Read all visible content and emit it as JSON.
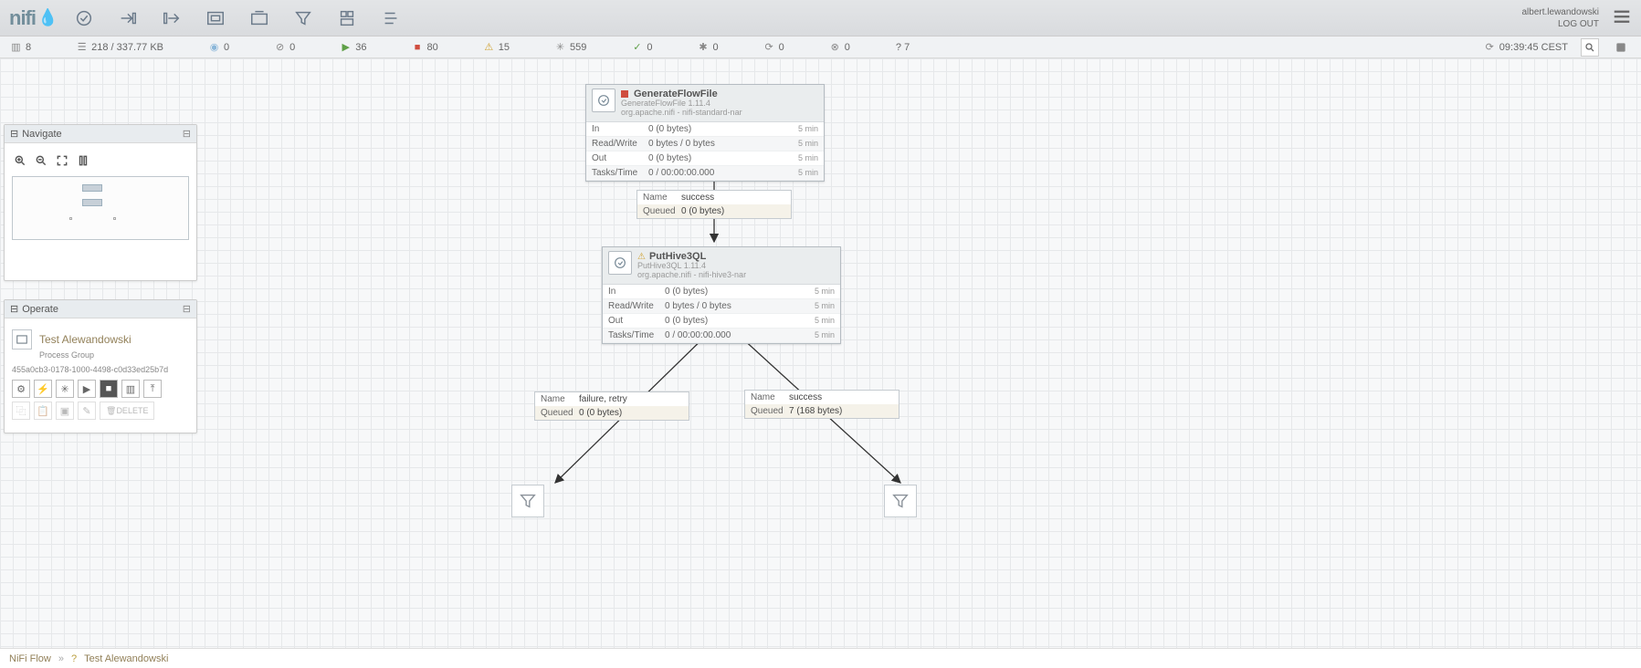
{
  "app": {
    "name": "nifi"
  },
  "user": {
    "name": "albert.lewandowski",
    "logout": "LOG OUT"
  },
  "status": {
    "groups": "8",
    "queue": "218 / 337.77 KB",
    "transmitting": "0",
    "not_transmitting": "0",
    "running": "36",
    "stopped": "80",
    "invalid": "15",
    "disabled": "559",
    "up_to_date": "0",
    "locally_modified": "0",
    "stale": "0",
    "sync_failure": "0",
    "unknown": "? 7",
    "refresh_time": "09:39:45 CEST"
  },
  "panels": {
    "navigate": {
      "title": "Navigate"
    },
    "operate": {
      "title": "Operate",
      "group_name": "Test Alewandowski",
      "group_type": "Process Group",
      "group_id": "455a0cb3-0178-1000-4498-c0d33ed25b7d",
      "delete_label": "DELETE"
    }
  },
  "processors": {
    "gff": {
      "name": "GenerateFlowFile",
      "type": "GenerateFlowFile 1.11.4",
      "bundle": "org.apache.nifi - nifi-standard-nar",
      "stats": {
        "in_label": "In",
        "in": "0 (0 bytes)",
        "in_t": "5 min",
        "rw_label": "Read/Write",
        "rw": "0 bytes / 0 bytes",
        "rw_t": "5 min",
        "out_label": "Out",
        "out": "0 (0 bytes)",
        "out_t": "5 min",
        "tasks_label": "Tasks/Time",
        "tasks": "0 / 00:00:00.000",
        "tasks_t": "5 min"
      }
    },
    "ph3": {
      "name": "PutHive3QL",
      "type": "PutHive3QL 1.11.4",
      "bundle": "org.apache.nifi - nifi-hive3-nar",
      "stats": {
        "in_label": "In",
        "in": "0 (0 bytes)",
        "in_t": "5 min",
        "rw_label": "Read/Write",
        "rw": "0 bytes / 0 bytes",
        "rw_t": "5 min",
        "out_label": "Out",
        "out": "0 (0 bytes)",
        "out_t": "5 min",
        "tasks_label": "Tasks/Time",
        "tasks": "0 / 00:00:00.000",
        "tasks_t": "5 min"
      }
    }
  },
  "connections": {
    "c1": {
      "name_label": "Name",
      "name": "success",
      "q_label": "Queued",
      "q": "0 (0 bytes)"
    },
    "c2": {
      "name_label": "Name",
      "name": "failure, retry",
      "q_label": "Queued",
      "q": "0 (0 bytes)"
    },
    "c3": {
      "name_label": "Name",
      "name": "success",
      "q_label": "Queued",
      "q": "7 (168 bytes)"
    }
  },
  "footer": {
    "root": "NiFi Flow",
    "current": "Test Alewandowski"
  }
}
